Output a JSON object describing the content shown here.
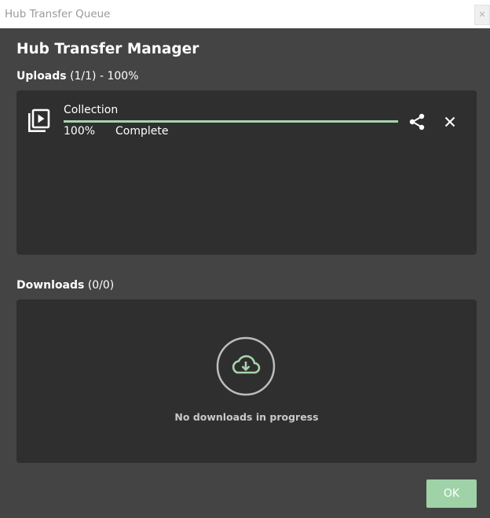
{
  "window": {
    "title": "Hub Transfer Queue",
    "close_glyph": "✕"
  },
  "header": {
    "title": "Hub Transfer Manager"
  },
  "uploads": {
    "label": "Uploads",
    "count": "(1/1) - 100%",
    "items": [
      {
        "name": "Collection",
        "progress_percent": 100,
        "progress_text": "100%",
        "status": "Complete",
        "icon": "video-collection-icon"
      }
    ]
  },
  "downloads": {
    "label": "Downloads",
    "count": "(0/0)",
    "empty_icon": "cloud-download-icon",
    "empty_text": "No downloads in progress"
  },
  "footer": {
    "ok_label": "OK"
  },
  "colors": {
    "background": "#444444",
    "panel": "#2f2f2f",
    "accent": "#a6d4ac",
    "ok_button": "#9fd2a7"
  }
}
